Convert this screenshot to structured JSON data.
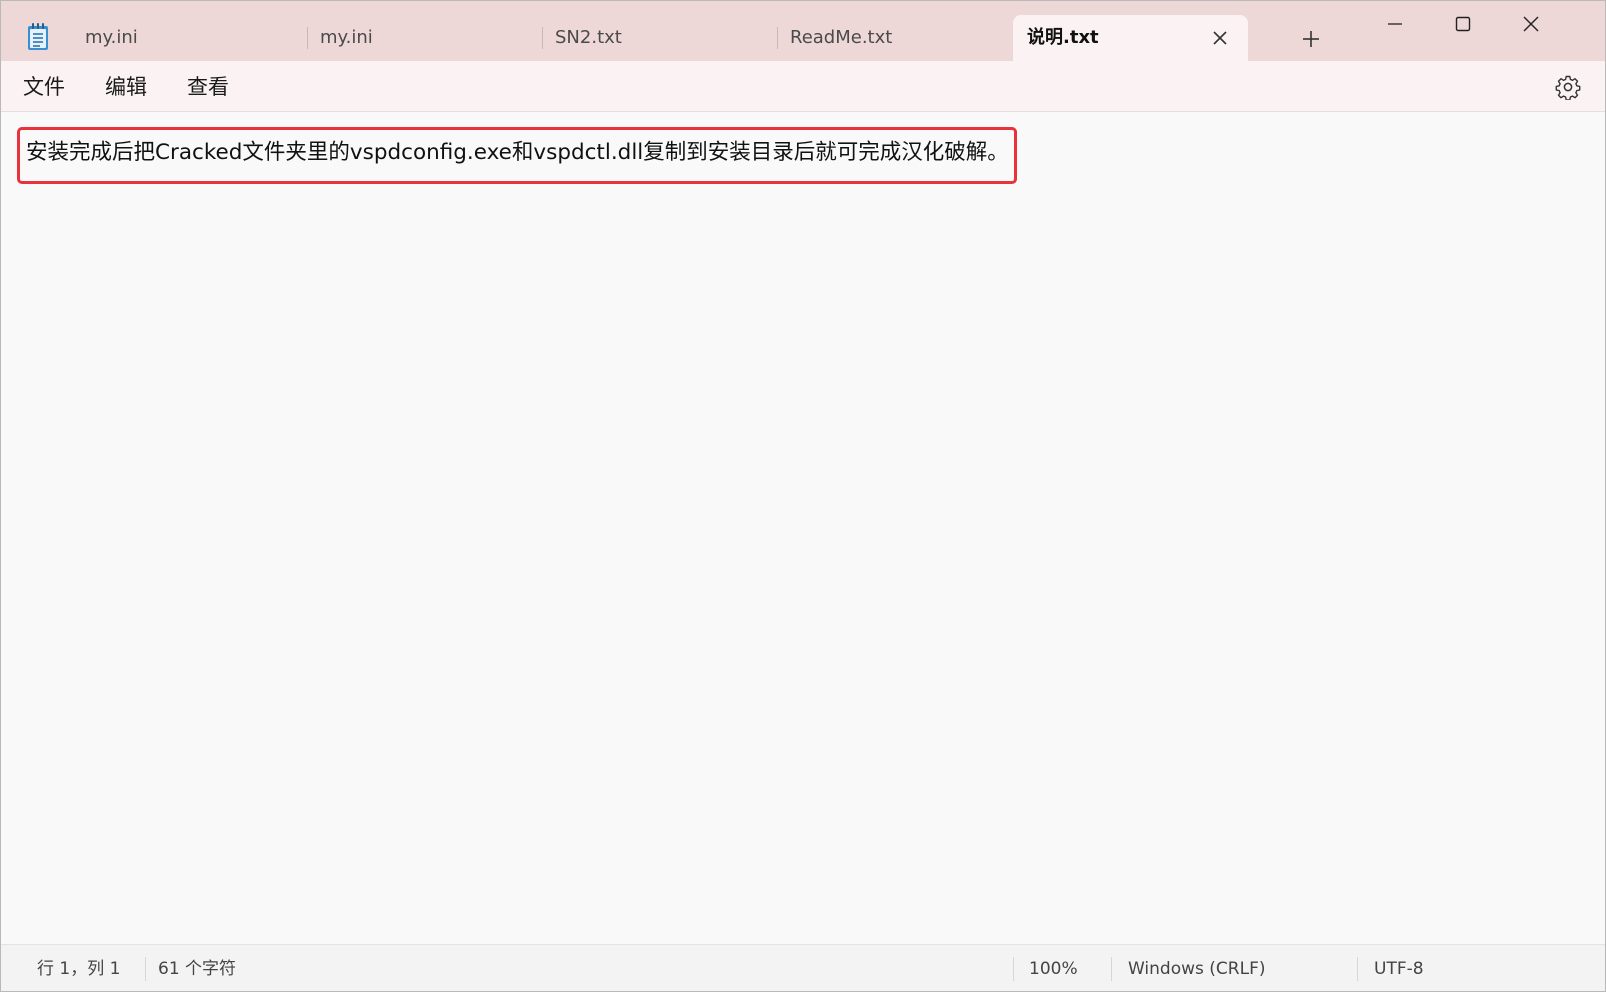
{
  "window": {
    "tabs": [
      {
        "label": "my.ini",
        "active": false
      },
      {
        "label": "my.ini",
        "active": false
      },
      {
        "label": "SN2.txt",
        "active": false
      },
      {
        "label": "ReadMe.txt",
        "active": false
      },
      {
        "label": "说明.txt",
        "active": true
      }
    ],
    "controls": [
      "minimize-icon",
      "maximize-icon",
      "close-icon"
    ]
  },
  "menu": {
    "file": "文件",
    "edit": "编辑",
    "view": "查看"
  },
  "editor": {
    "content": "安装完成后把Cracked文件夹里的vspdconfig.exe和vspdctl.dll复制到安装目录后就可完成汉化破解。",
    "highlight_color": "#e8323c"
  },
  "status": {
    "position": "行 1，列 1",
    "char_count": "61 个字符",
    "zoom": "100%",
    "line_ending": "Windows (CRLF)",
    "encoding": "UTF-8"
  },
  "colors": {
    "titlebar": "#eed7d7",
    "active_tab": "#fbf3f3",
    "editor_bg": "#f9f9f9",
    "status_bg": "#f3f3f3"
  }
}
